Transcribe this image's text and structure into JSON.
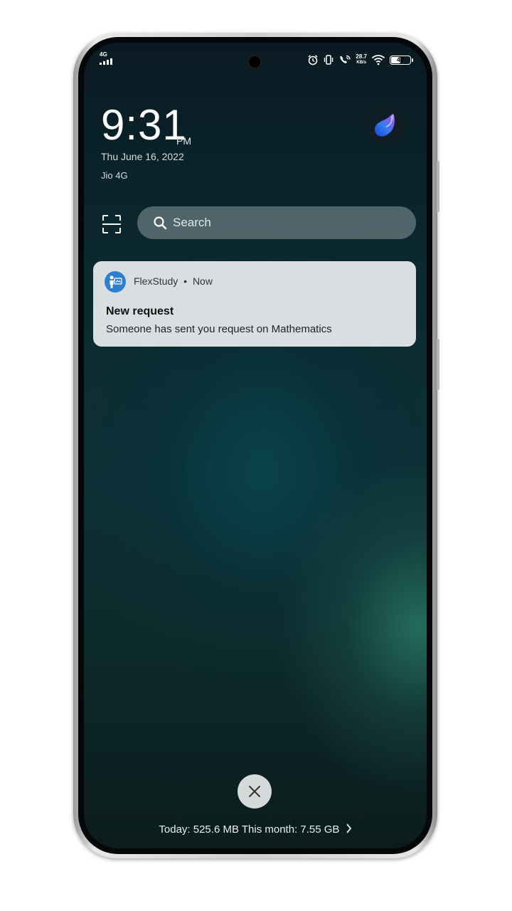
{
  "status_bar": {
    "network_type": "4G",
    "speed_value": "28.7",
    "speed_unit": "KB/s",
    "battery_level": "47",
    "icons": [
      "alarm-icon",
      "vibrate-icon",
      "wifi-calling-icon",
      "wifi-icon",
      "battery-icon"
    ]
  },
  "lockscreen": {
    "time": "9:31",
    "ampm": "PM",
    "date": "Thu June 16, 2022",
    "carrier": "Jio 4G"
  },
  "search": {
    "placeholder": "Search"
  },
  "notification": {
    "app_name": "FlexStudy",
    "separator": "•",
    "time": "Now",
    "title": "New request",
    "body": "Someone has sent you request on Mathematics",
    "app_icon_color": "#2d7fd0"
  },
  "footer": {
    "data_usage": "Today: 525.6 MB This month: 7.55 GB"
  },
  "colors": {
    "frame": "#cfcfcf",
    "card_bg": "#d9dfe1",
    "close_btn_bg": "#d6d9da"
  }
}
